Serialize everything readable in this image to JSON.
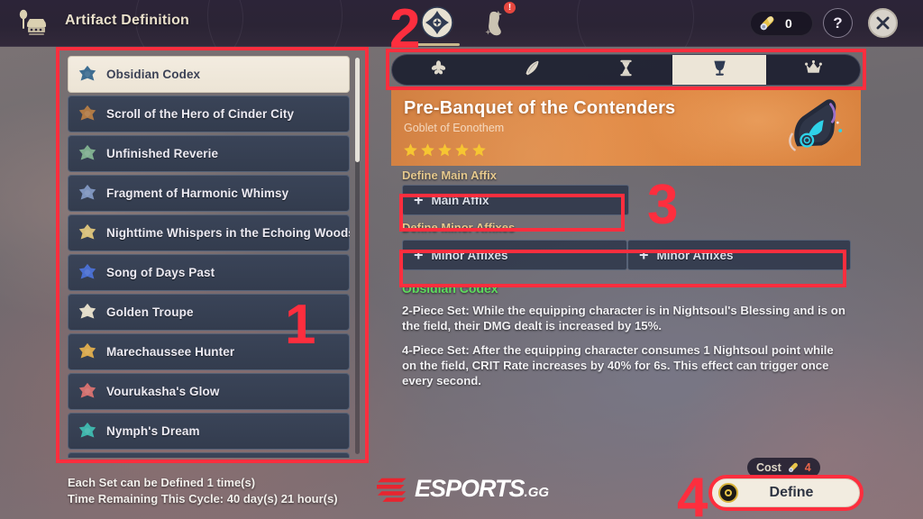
{
  "window": {
    "title": "Artifact Definition",
    "icon": "alchemy-table-icon"
  },
  "topbar": {
    "category_tabs": [
      {
        "name": "artifact-definition-tab",
        "icon": "artifact-emblem-icon",
        "active": true,
        "badge": ""
      },
      {
        "name": "artifact-transmute-tab",
        "icon": "artifact-vessel-icon",
        "active": false,
        "badge": "!"
      }
    ],
    "currency": {
      "icon": "definition-essence-icon",
      "value": "0"
    },
    "help_label": "?",
    "close_icon": "close-icon"
  },
  "artifact_list": {
    "items": [
      {
        "label": "Obsidian Codex",
        "icon": "obsidian-codex-icon",
        "color": "#3e6d91",
        "selected": true
      },
      {
        "label": "Scroll of the Hero of Cinder City",
        "icon": "scroll-hero-cinder-city-icon",
        "color": "#b07a45",
        "selected": false
      },
      {
        "label": "Unfinished Reverie",
        "icon": "unfinished-reverie-icon",
        "color": "#7fae8f",
        "selected": false
      },
      {
        "label": "Fragment of Harmonic Whimsy",
        "icon": "fragment-harmonic-whimsy-icon",
        "color": "#7e94bd",
        "selected": false
      },
      {
        "label": "Nighttime Whispers in the Echoing Woods",
        "icon": "nighttime-whispers-icon",
        "color": "#d8c07a",
        "selected": false
      },
      {
        "label": "Song of Days Past",
        "icon": "song-of-days-past-icon",
        "color": "#4a6fd0",
        "selected": false
      },
      {
        "label": "Golden Troupe",
        "icon": "golden-troupe-icon",
        "color": "#e3dcc9",
        "selected": false
      },
      {
        "label": "Marechaussee Hunter",
        "icon": "marechaussee-hunter-icon",
        "color": "#d9a94e",
        "selected": false
      },
      {
        "label": "Vourukasha's Glow",
        "icon": "vourukashas-glow-icon",
        "color": "#d2706f",
        "selected": false
      },
      {
        "label": "Nymph's Dream",
        "icon": "nymphs-dream-icon",
        "color": "#3fb5ac",
        "selected": false
      },
      {
        "label": "",
        "icon": "partial-row-icon",
        "color": "#46506a",
        "selected": false
      }
    ]
  },
  "slot_tabs": [
    {
      "name": "flower-of-life-tab",
      "icon": "flower-icon",
      "active": false
    },
    {
      "name": "plume-of-death-tab",
      "icon": "plume-icon",
      "active": false
    },
    {
      "name": "sands-of-eon-tab",
      "icon": "hourglass-icon",
      "active": false
    },
    {
      "name": "goblet-of-eonothem-tab",
      "icon": "goblet-icon",
      "active": true
    },
    {
      "name": "circlet-of-logos-tab",
      "icon": "crown-icon",
      "active": false
    }
  ],
  "detail": {
    "name": "Pre-Banquet of the Contenders",
    "slot": "Goblet of Eonothem",
    "rarity": 5,
    "thumb_icon": "goblet-artifact-icon",
    "main_affix_label": "Define Main Affix",
    "main_affix_button": "Main Affix",
    "minor_affix_label": "Define Minor Affixes",
    "minor_affix_buttons": [
      "Minor Affixes",
      "Minor Affixes"
    ],
    "set_name": "Obsidian Codex",
    "set_bonuses": [
      "2-Piece Set: While the equipping character is in Nightsoul's Blessing and is on the field, their DMG dealt is increased by 15%.",
      "4-Piece Set: After the equipping character consumes 1 Nightsoul point while on the field, CRIT Rate increases by 40% for 6s. This effect can trigger once every second."
    ]
  },
  "footer": {
    "line1": "Each Set can be Defined 1 time(s)",
    "line2": "Time Remaining This Cycle: 40 day(s) 21 hour(s)",
    "watermark": "ESPORTS",
    "watermark_suffix": ".GG",
    "cost_label": "Cost",
    "cost_icon": "definition-essence-icon",
    "cost_value": "4",
    "define_button": "Define"
  },
  "annotations": [
    {
      "id": "1",
      "target": "artifact-list"
    },
    {
      "id": "2",
      "target": "slot-tabs-and-category-tabs"
    },
    {
      "id": "3",
      "target": "affix-definition-area"
    },
    {
      "id": "4",
      "target": "define-button"
    }
  ],
  "colors": {
    "annotation": "#fd2e3e",
    "accent_gold": "#e5c88d",
    "set_green": "#5ddd5d",
    "header_orange": "#d9823e"
  }
}
